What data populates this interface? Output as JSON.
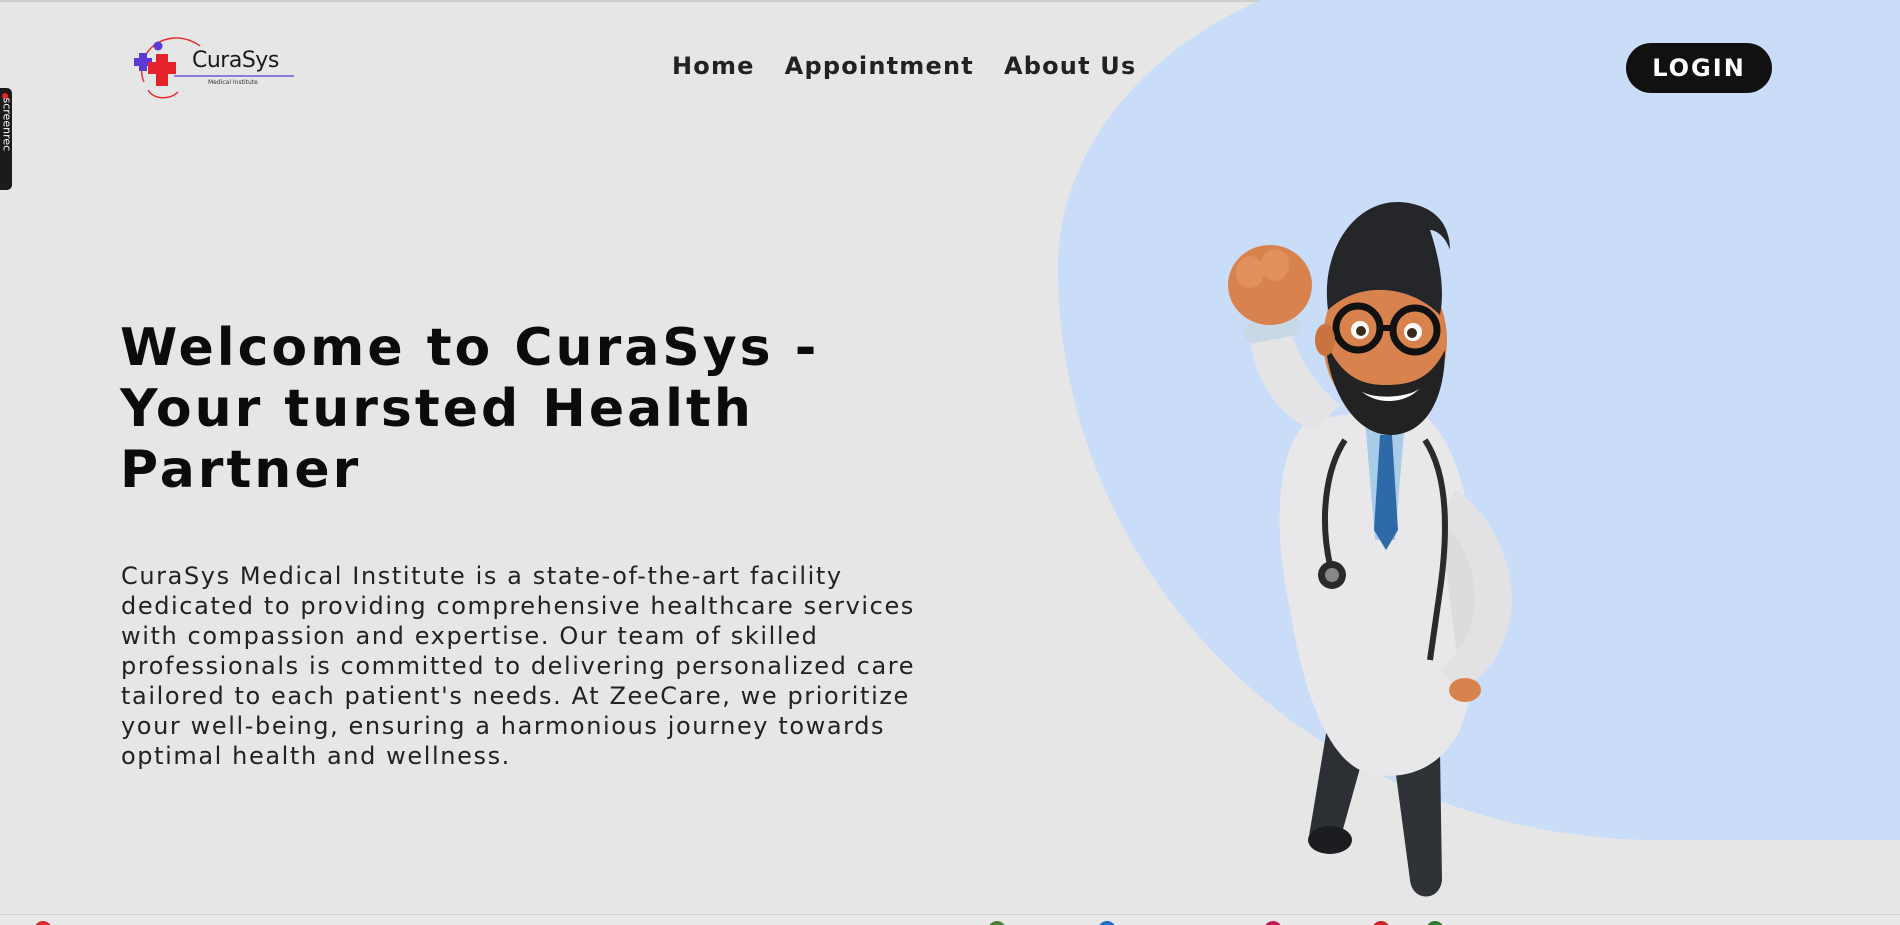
{
  "brand": {
    "name": "CuraSys",
    "tagline": "Medical Institute",
    "colors": {
      "primary_red": "#e8242b",
      "accent_purple": "#5b3ad6"
    }
  },
  "nav": {
    "links": [
      "Home",
      "Appointment",
      "About Us"
    ],
    "login_label": "LOGIN"
  },
  "hero": {
    "title": "Welcome to CuraSys - Your tursted Health Partner",
    "description": "CuraSys Medical Institute is a state-of-the-art facility dedicated to providing comprehensive healthcare services with compassion and expertise. Our team of skilled professionals is committed to delivering personalized care tailored to each patient's needs. At ZeeCare, we prioritize your well-being, ensuring a harmonious journey towards optimal health and wellness.",
    "image_icon": "doctor-cartoon-illustration",
    "bg_shape_color": "#c9dcf8"
  },
  "overlay": {
    "screenrec_label": "screenrec"
  }
}
